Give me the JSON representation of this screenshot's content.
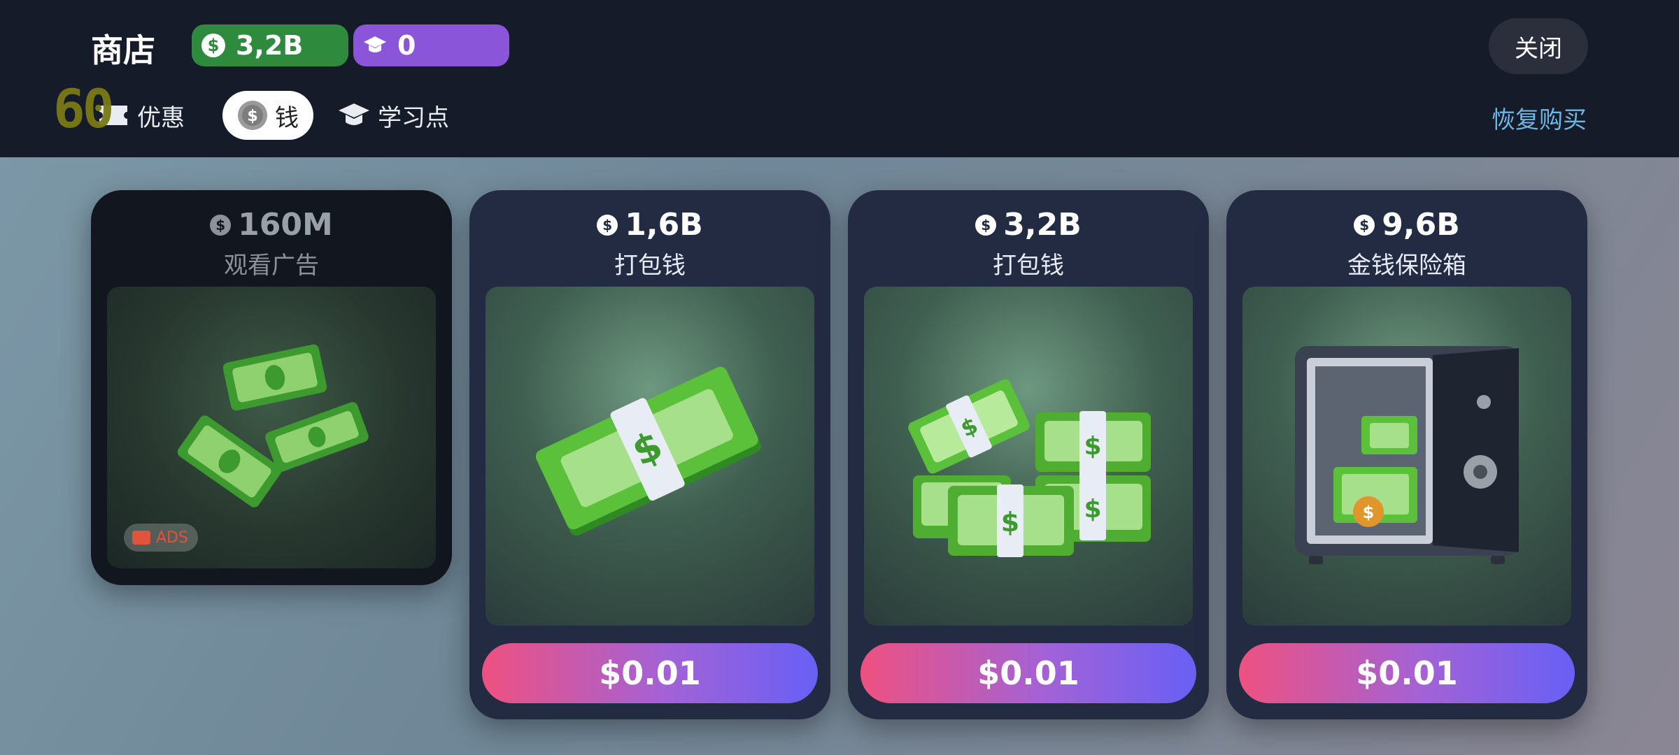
{
  "header": {
    "title": "商店",
    "money_balance": "3,2B",
    "study_balance": "0",
    "close_label": "关闭",
    "fps_counter": "60",
    "restore_label": "恢复购买"
  },
  "tabs": [
    {
      "label": "优惠",
      "icon": "ticket-icon",
      "active": false
    },
    {
      "label": "钱",
      "icon": "coin-icon",
      "active": true
    },
    {
      "label": "学习点",
      "icon": "graduation-cap-icon",
      "active": false
    }
  ],
  "offers": [
    {
      "amount": "160M",
      "label": "观看广告",
      "badge": "ADS",
      "art": "floating-bills",
      "price": null
    },
    {
      "amount": "1,6B",
      "label": "打包钱",
      "art": "cash-bundle",
      "price": "$0.01"
    },
    {
      "amount": "3,2B",
      "label": "打包钱",
      "art": "cash-stacks",
      "price": "$0.01"
    },
    {
      "amount": "9,6B",
      "label": "金钱保险箱",
      "art": "money-safe",
      "price": "$0.01"
    }
  ],
  "colors": {
    "money_pill": "#2e8a3c",
    "study_pill": "#8a55d9",
    "card_bg": "#232b42",
    "restore_link": "#6db6e3",
    "buy_gradient": [
      "#ee5180",
      "#6860f5"
    ]
  }
}
